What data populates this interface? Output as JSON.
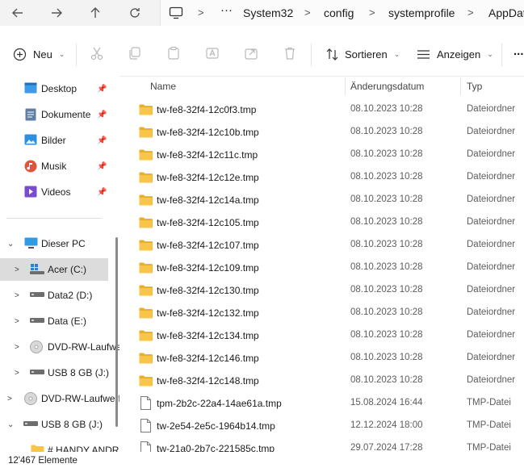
{
  "address": {
    "crumbs": [
      "System32",
      "config",
      "systemprofile",
      "AppData"
    ]
  },
  "toolbar": {
    "new_label": "Neu",
    "sort_label": "Sortieren",
    "view_label": "Anzeigen",
    "more_label": "..."
  },
  "sidebar": {
    "quick": [
      {
        "label": "Desktop",
        "icon": "desktop-icon"
      },
      {
        "label": "Dokumente",
        "icon": "documents-icon"
      },
      {
        "label": "Bilder",
        "icon": "pictures-icon"
      },
      {
        "label": "Musik",
        "icon": "music-icon"
      },
      {
        "label": "Videos",
        "icon": "videos-icon"
      }
    ],
    "this_pc": "Dieser PC",
    "drives": [
      {
        "label": "Acer (C:)",
        "selected": true
      },
      {
        "label": "Data2 (D:)"
      },
      {
        "label": "Data (E:)"
      },
      {
        "label": "DVD-RW-Laufwerk"
      },
      {
        "label": "USB 8 GB (J:)"
      }
    ],
    "top_dvd": "DVD-RW-Laufwerk",
    "top_usb": "USB 8 GB (J:)",
    "usb_child": "# HANDY ANDROID"
  },
  "list": {
    "columns": {
      "name": "Name",
      "date": "Änderungsdatum",
      "type": "Typ"
    },
    "rows": [
      {
        "name": "tw-fe8-32f4-12c0f3.tmp",
        "date": "08.10.2023 10:28",
        "type": "Dateiordner",
        "kind": "folder"
      },
      {
        "name": "tw-fe8-32f4-12c10b.tmp",
        "date": "08.10.2023 10:28",
        "type": "Dateiordner",
        "kind": "folder"
      },
      {
        "name": "tw-fe8-32f4-12c11c.tmp",
        "date": "08.10.2023 10:28",
        "type": "Dateiordner",
        "kind": "folder"
      },
      {
        "name": "tw-fe8-32f4-12c12e.tmp",
        "date": "08.10.2023 10:28",
        "type": "Dateiordner",
        "kind": "folder"
      },
      {
        "name": "tw-fe8-32f4-12c14a.tmp",
        "date": "08.10.2023 10:28",
        "type": "Dateiordner",
        "kind": "folder"
      },
      {
        "name": "tw-fe8-32f4-12c105.tmp",
        "date": "08.10.2023 10:28",
        "type": "Dateiordner",
        "kind": "folder"
      },
      {
        "name": "tw-fe8-32f4-12c107.tmp",
        "date": "08.10.2023 10:28",
        "type": "Dateiordner",
        "kind": "folder"
      },
      {
        "name": "tw-fe8-32f4-12c109.tmp",
        "date": "08.10.2023 10:28",
        "type": "Dateiordner",
        "kind": "folder"
      },
      {
        "name": "tw-fe8-32f4-12c130.tmp",
        "date": "08.10.2023 10:28",
        "type": "Dateiordner",
        "kind": "folder"
      },
      {
        "name": "tw-fe8-32f4-12c132.tmp",
        "date": "08.10.2023 10:28",
        "type": "Dateiordner",
        "kind": "folder"
      },
      {
        "name": "tw-fe8-32f4-12c134.tmp",
        "date": "08.10.2023 10:28",
        "type": "Dateiordner",
        "kind": "folder"
      },
      {
        "name": "tw-fe8-32f4-12c146.tmp",
        "date": "08.10.2023 10:28",
        "type": "Dateiordner",
        "kind": "folder"
      },
      {
        "name": "tw-fe8-32f4-12c148.tmp",
        "date": "08.10.2023 10:28",
        "type": "Dateiordner",
        "kind": "folder"
      },
      {
        "name": "tpm-2b2c-22a4-14ae61a.tmp",
        "date": "15.08.2024 16:44",
        "type": "TMP-Datei",
        "kind": "file"
      },
      {
        "name": "tw-2e54-2e5c-1964b14.tmp",
        "date": "12.12.2024 18:00",
        "type": "TMP-Datei",
        "kind": "file"
      },
      {
        "name": "tw-21a0-2b7c-221585c.tmp",
        "date": "29.07.2024 17:28",
        "type": "TMP-Datei",
        "kind": "file"
      }
    ]
  },
  "status": {
    "count": "12'467 Elemente"
  },
  "colors": {
    "folder": "#f7c548",
    "folder_dark": "#e8ae2a",
    "selection": "#dcdcdc",
    "accent": "#0067c0"
  }
}
